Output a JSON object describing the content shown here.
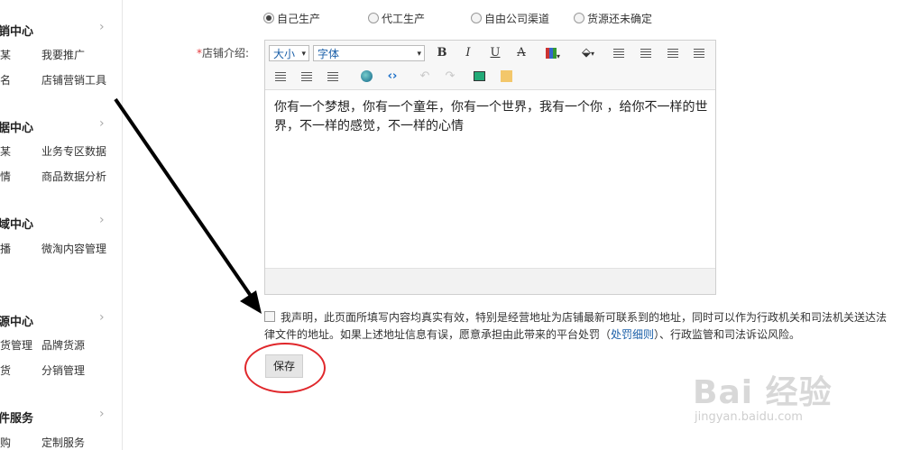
{
  "sidebar": {
    "sections": [
      {
        "title": "销中心",
        "links": [
          "某",
          "我要推广",
          "名",
          "店铺营销工具"
        ]
      },
      {
        "title": "据中心",
        "links": [
          "某",
          "业务专区数据",
          "情",
          "商品数据分析"
        ]
      },
      {
        "title": "域中心",
        "links": [
          "播",
          "微淘内容管理"
        ]
      },
      {
        "title": "源中心",
        "links": [
          "货管理",
          "品牌货源",
          "货",
          "分销管理"
        ]
      },
      {
        "title": "件服务",
        "links": [
          "购",
          "定制服务"
        ]
      }
    ],
    "chevron": "›"
  },
  "source_options": [
    {
      "label": "自己生产",
      "selected": true
    },
    {
      "label": "代工生产",
      "selected": false
    },
    {
      "label": "自由公司渠道",
      "selected": false
    },
    {
      "label": "货源还未确定",
      "selected": false
    }
  ],
  "intro": {
    "required_mark": "*",
    "label": "店铺介绍:",
    "size_select": "大小",
    "font_select": "字体",
    "toolbar_icons": [
      "bold-icon",
      "italic-icon",
      "underline-icon",
      "strikethrough-icon",
      "table-icon",
      "fill-color-icon",
      "align-left-icon",
      "align-center-icon",
      "align-right-icon",
      "bullet-list-icon",
      "numbered-list-icon",
      "outdent-icon",
      "indent-icon",
      "globe-link-icon",
      "code-icon",
      "undo-icon",
      "redo-icon",
      "image-icon",
      "flash-icon"
    ],
    "text": "你有一个梦想，你有一个童年，你有一个世界，我有一个你 ，给你不一样的世界，不一样的感觉，不一样的心情"
  },
  "declaration": {
    "text_before": "我声明，此页面所填写内容均真实有效，特别是经营地址为店铺最新可联系到的地址，同时可以作为行政机关和司法机关送达法律文件的地址。如果上述地址信息有误，愿意承担由此带来的平台处罚（",
    "link": "处罚细则",
    "text_after": "）、行政监管和司法诉讼风险。"
  },
  "save_label": "保存",
  "colors": {
    "accent_link": "#1a5fa8",
    "required": "#e4393c",
    "annotation": "#e0272b"
  },
  "watermark": {
    "logo": "Bai 经验",
    "url": "jingyan.baidu.com"
  }
}
